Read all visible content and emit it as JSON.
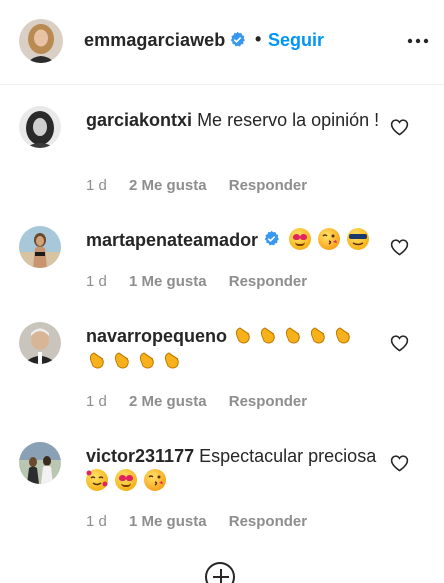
{
  "header": {
    "username": "emmagarciaweb",
    "separator": "•",
    "follow_label": "Seguir",
    "more_icon": "more-horizontal-icon"
  },
  "comments": [
    {
      "username": "garciakontxi",
      "text": "Me reservo la opinión !",
      "time": "1 d",
      "likes": "2 Me gusta",
      "reply": "Responder"
    },
    {
      "username": "martapenateamador",
      "verified": true,
      "text": "",
      "emojis": [
        "heart-eyes-face",
        "kissing-face",
        "sunglasses-face"
      ],
      "time": "1 d",
      "likes": "1 Me gusta",
      "reply": "Responder"
    },
    {
      "username": "navarropequeno",
      "text": "",
      "emojis": [
        "clapping-hands",
        "clapping-hands",
        "clapping-hands",
        "clapping-hands",
        "clapping-hands",
        "clapping-hands",
        "clapping-hands",
        "clapping-hands",
        "clapping-hands"
      ],
      "time": "1 d",
      "likes": "2 Me gusta",
      "reply": "Responder"
    },
    {
      "username": "victor231177",
      "text": "Espectacular preciosa",
      "emojis": [
        "smiling-face-with-hearts",
        "heart-eyes-face",
        "kissing-face"
      ],
      "time": "1 d",
      "likes": "1 Me gusta",
      "reply": "Responder"
    }
  ],
  "colors": {
    "accent": "#0095f6",
    "text": "#262626",
    "muted": "#8e8e8e"
  }
}
